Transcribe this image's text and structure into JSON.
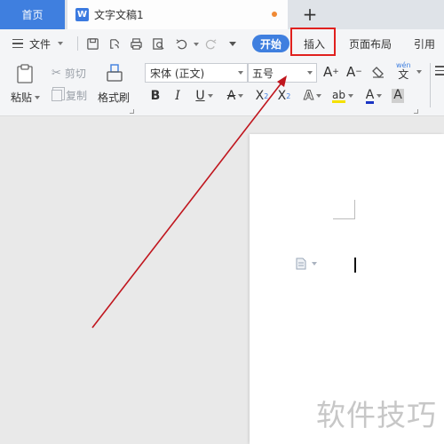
{
  "tabs": {
    "home_label": "首页",
    "doc_icon_letter": "W",
    "doc_title": "文字文稿1",
    "add_label": "+"
  },
  "menu": {
    "file_label": "文件",
    "items": [
      "开始",
      "插入",
      "页面布局",
      "引用"
    ]
  },
  "ribbon": {
    "paste_label": "粘贴",
    "cut_label": "剪切",
    "copy_label": "复制",
    "format_painter_label": "格式刷",
    "font_name": "宋体 (正文)",
    "font_size": "五号",
    "bold": "B",
    "italic": "I",
    "underline": "U",
    "strike": "A",
    "superscript": "X",
    "superscript_mark": "2",
    "subscript": "X",
    "subscript_mark": "2",
    "text_effect": "A",
    "highlight": "ab",
    "font_color": "A",
    "char_shading": "A",
    "grow_font": "A",
    "shrink_font": "A",
    "phonetic": "wén"
  },
  "watermark": "软件技巧",
  "colors": {
    "accent": "#3f7fdf",
    "highlight_border": "#e0201e",
    "arrow": "#c0161e"
  }
}
